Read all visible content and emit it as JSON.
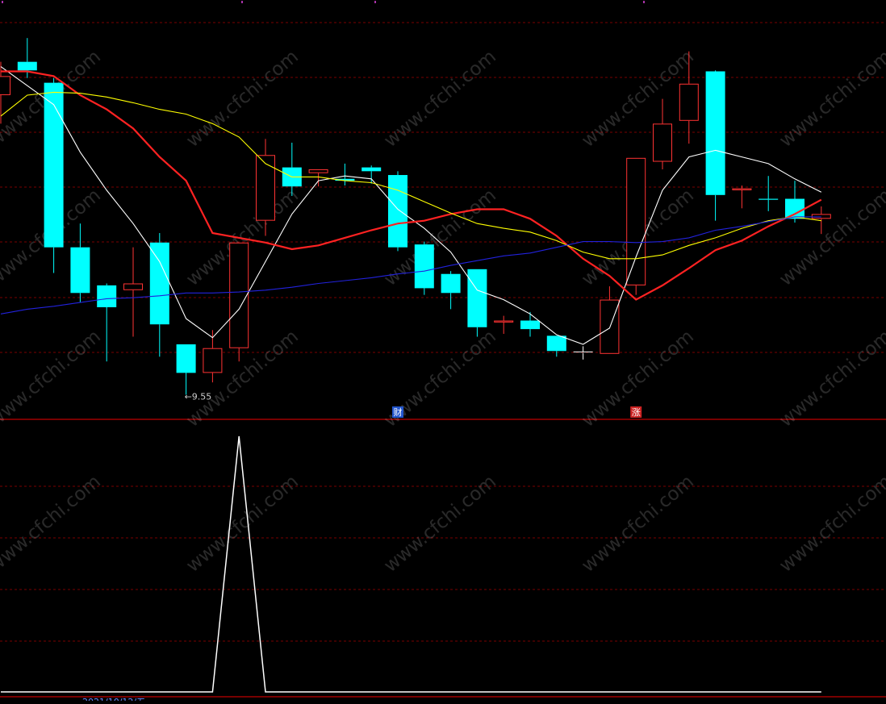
{
  "chart_data": [
    {
      "type": "candlestick",
      "panel": "main",
      "low_annotation": {
        "text": "←9.55",
        "candle_index": 7
      },
      "event_badges": [
        {
          "text": "财",
          "candle_index": 15,
          "color": "#2255cc"
        },
        {
          "text": "涨",
          "candle_index": 24,
          "color": "#cc2222"
        }
      ],
      "candles": [
        {
          "o": 12.7,
          "h": 13.05,
          "l": 12.4,
          "c": 12.9,
          "dir": "up"
        },
        {
          "o": 12.96,
          "h": 13.3,
          "l": 12.88,
          "c": 13.05,
          "dir": "down"
        },
        {
          "o": 12.83,
          "h": 12.88,
          "l": 10.83,
          "c": 11.1,
          "dir": "down"
        },
        {
          "o": 11.1,
          "h": 11.35,
          "l": 10.52,
          "c": 10.62,
          "dir": "down"
        },
        {
          "o": 10.7,
          "h": 10.72,
          "l": 9.9,
          "c": 10.47,
          "dir": "down"
        },
        {
          "o": 10.65,
          "h": 11.1,
          "l": 10.16,
          "c": 10.72,
          "dir": "up"
        },
        {
          "o": 11.15,
          "h": 11.25,
          "l": 9.95,
          "c": 10.29,
          "dir": "down"
        },
        {
          "o": 10.08,
          "h": 10.08,
          "l": 9.55,
          "c": 9.78,
          "dir": "down"
        },
        {
          "o": 9.78,
          "h": 10.23,
          "l": 9.68,
          "c": 10.04,
          "dir": "up"
        },
        {
          "o": 10.04,
          "h": 11.15,
          "l": 9.9,
          "c": 11.15,
          "dir": "up"
        },
        {
          "o": 11.38,
          "h": 12.24,
          "l": 11.22,
          "c": 12.07,
          "dir": "up"
        },
        {
          "o": 11.94,
          "h": 12.2,
          "l": 11.64,
          "c": 11.74,
          "dir": "down"
        },
        {
          "o": 11.92,
          "h": 11.92,
          "l": 11.74,
          "c": 11.88,
          "dir": "up"
        },
        {
          "o": 11.82,
          "h": 11.98,
          "l": 11.75,
          "c": 11.8,
          "dir": "down"
        },
        {
          "o": 11.94,
          "h": 11.96,
          "l": 11.77,
          "c": 11.9,
          "dir": "down"
        },
        {
          "o": 11.86,
          "h": 11.9,
          "l": 11.06,
          "c": 11.1,
          "dir": "down"
        },
        {
          "o": 11.13,
          "h": 11.16,
          "l": 10.6,
          "c": 10.67,
          "dir": "down"
        },
        {
          "o": 10.82,
          "h": 10.85,
          "l": 10.45,
          "c": 10.62,
          "dir": "down"
        },
        {
          "o": 10.87,
          "h": 10.87,
          "l": 10.16,
          "c": 10.26,
          "dir": "down"
        },
        {
          "o": 10.33,
          "h": 10.38,
          "l": 10.19,
          "c": 10.31,
          "dir": "up"
        },
        {
          "o": 10.33,
          "h": 10.42,
          "l": 10.16,
          "c": 10.24,
          "dir": "down"
        },
        {
          "o": 10.17,
          "h": 10.17,
          "l": 9.95,
          "c": 10.01,
          "dir": "down"
        },
        {
          "o": 10.0,
          "h": 10.06,
          "l": 9.92,
          "c": 9.99,
          "dir": "flat"
        },
        {
          "o": 9.98,
          "h": 10.69,
          "l": 9.98,
          "c": 10.55,
          "dir": "up"
        },
        {
          "o": 10.7,
          "h": 12.04,
          "l": 10.6,
          "c": 12.04,
          "dir": "up"
        },
        {
          "o": 12.0,
          "h": 12.66,
          "l": 11.92,
          "c": 12.4,
          "dir": "up"
        },
        {
          "o": 12.43,
          "h": 13.16,
          "l": 12.19,
          "c": 12.82,
          "dir": "up"
        },
        {
          "o": 12.95,
          "h": 12.96,
          "l": 11.38,
          "c": 11.65,
          "dir": "down"
        },
        {
          "o": 11.72,
          "h": 11.75,
          "l": 11.51,
          "c": 11.7,
          "dir": "up"
        },
        {
          "o": 11.61,
          "h": 11.85,
          "l": 11.48,
          "c": 11.6,
          "dir": "down"
        },
        {
          "o": 11.61,
          "h": 11.8,
          "l": 11.36,
          "c": 11.4,
          "dir": "down"
        },
        {
          "o": 11.4,
          "h": 11.53,
          "l": 11.24,
          "c": 11.45,
          "dir": "up"
        }
      ],
      "ylim": [
        9.3,
        13.7
      ],
      "series": [
        {
          "color": "#ffffff",
          "values": [
            13.0,
            12.8,
            12.6,
            12.1,
            11.7,
            11.35,
            10.95,
            10.35,
            10.15,
            10.45,
            10.95,
            11.45,
            11.8,
            11.85,
            11.82,
            11.5,
            11.3,
            11.05,
            10.65,
            10.55,
            10.4,
            10.18,
            10.08,
            10.25,
            11.0,
            11.7,
            12.05,
            12.12,
            12.05,
            11.98,
            11.82,
            11.68
          ]
        },
        {
          "color": "#ff2222",
          "values": [
            12.95,
            12.95,
            12.9,
            12.7,
            12.55,
            12.35,
            12.05,
            11.8,
            11.25,
            11.2,
            11.15,
            11.08,
            11.12,
            11.2,
            11.28,
            11.35,
            11.38,
            11.45,
            11.5,
            11.5,
            11.4,
            11.22,
            10.98,
            10.8,
            10.55,
            10.7,
            10.88,
            11.07,
            11.17,
            11.32,
            11.45,
            11.6
          ]
        },
        {
          "color": "#ffff00",
          "values": [
            12.48,
            12.7,
            12.73,
            12.72,
            12.68,
            12.62,
            12.55,
            12.5,
            12.4,
            12.26,
            11.98,
            11.84,
            11.84,
            11.8,
            11.78,
            11.7,
            11.58,
            11.46,
            11.35,
            11.3,
            11.26,
            11.17,
            11.05,
            10.98,
            10.98,
            11.02,
            11.12,
            11.2,
            11.3,
            11.38,
            11.42,
            11.38
          ]
        },
        {
          "color": "#2222dd",
          "values": [
            10.4,
            10.45,
            10.48,
            10.52,
            10.56,
            10.57,
            10.59,
            10.62,
            10.62,
            10.63,
            10.65,
            10.68,
            10.72,
            10.75,
            10.78,
            10.82,
            10.85,
            10.91,
            10.96,
            11.01,
            11.04,
            11.1,
            11.16,
            11.16,
            11.15,
            11.16,
            11.2,
            11.28,
            11.32,
            11.37,
            11.42,
            11.42
          ]
        }
      ]
    },
    {
      "type": "line",
      "panel": "indicator",
      "ylim": [
        0,
        1
      ],
      "series": [
        {
          "color": "#ffffff",
          "values": [
            0,
            0,
            0,
            0,
            0,
            0,
            0,
            0,
            0,
            1,
            0,
            0,
            0,
            0,
            0,
            0,
            0,
            0,
            0,
            0,
            0,
            0,
            0,
            0,
            0,
            0,
            0,
            0,
            0,
            0,
            0,
            0
          ]
        }
      ]
    }
  ],
  "watermark": {
    "text": "www.cfchi.com"
  },
  "footer": {
    "date_text": "2021/10/12/五"
  },
  "colors": {
    "background": "#000000",
    "up": "#ff3333",
    "down": "#00ffff",
    "grid": "#7a0000",
    "separator": "#a00000",
    "annotation": "#cccccc"
  }
}
